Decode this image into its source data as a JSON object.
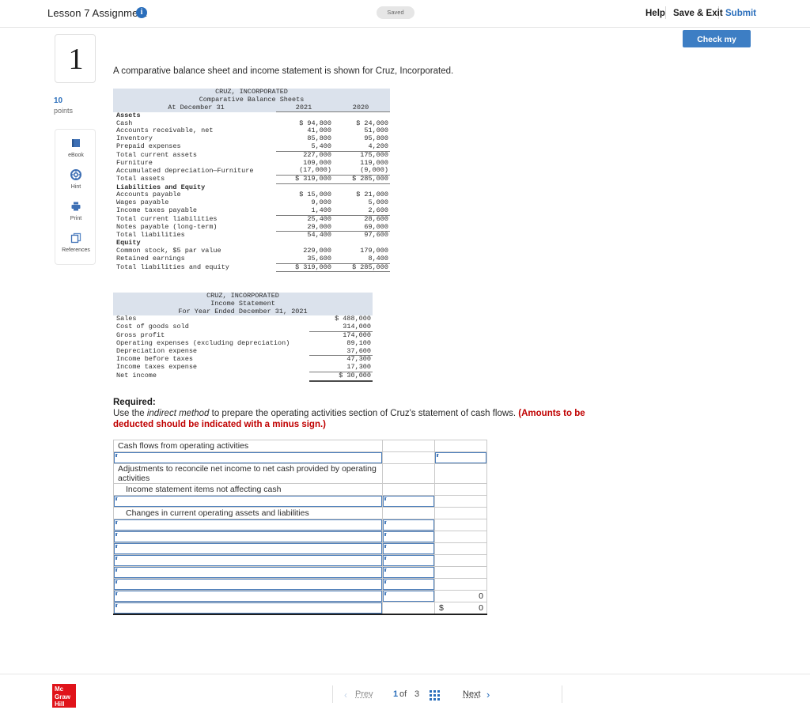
{
  "topbar": {
    "assignment_title": "Lesson 7 Assignment",
    "info_icon": "info-icon",
    "saved_label": "Saved",
    "help_label": "Help",
    "save_exit_label": "Save & Exit",
    "submit_label": "Submit",
    "check_my_work_label": "Check my work",
    "accent_blue": "#3d7ec4"
  },
  "left_rail": {
    "question_number": "1",
    "points_value": "10",
    "points_label": "points",
    "tools": [
      {
        "label": "eBook",
        "icon": "book-icon"
      },
      {
        "label": "Hint",
        "icon": "lifebuoy-icon"
      },
      {
        "label": "Print",
        "icon": "printer-icon"
      },
      {
        "label": "References",
        "icon": "copy-icon"
      }
    ]
  },
  "prompt": "A comparative balance sheet and income statement is shown for Cruz, Incorporated.",
  "balance_sheet": {
    "company": "CRUZ, INCORPORATED",
    "title": "Comparative Balance Sheets",
    "row_label_header": "At December 31",
    "col_2021": "2021",
    "col_2020": "2020",
    "rows": [
      {
        "label": "Assets",
        "bold": true,
        "v2021": "",
        "v2020": ""
      },
      {
        "label": "Cash",
        "v2021": "$ 94,800",
        "v2020": "$ 24,000"
      },
      {
        "label": "Accounts receivable, net",
        "v2021": "41,000",
        "v2020": "51,000"
      },
      {
        "label": "Inventory",
        "v2021": "85,800",
        "v2020": "95,800"
      },
      {
        "label": "Prepaid expenses",
        "v2021": "5,400",
        "v2020": "4,200",
        "rule": true
      },
      {
        "label": "Total current assets",
        "v2021": "227,000",
        "v2020": "175,000"
      },
      {
        "label": "Furniture",
        "v2021": "109,000",
        "v2020": "119,000"
      },
      {
        "label": "Accumulated depreciation—Furniture",
        "v2021": "(17,000)",
        "v2020": "(9,000)",
        "rule": true
      },
      {
        "label": "Total assets",
        "v2021": "$ 319,000",
        "v2020": "$ 285,000",
        "rule_after": true
      },
      {
        "label": "Liabilities and Equity",
        "bold": true,
        "v2021": "",
        "v2020": ""
      },
      {
        "label": "Accounts payable",
        "v2021": "$ 15,000",
        "v2020": "$ 21,000"
      },
      {
        "label": "Wages payable",
        "v2021": "9,000",
        "v2020": "5,000"
      },
      {
        "label": "Income taxes payable",
        "v2021": "1,400",
        "v2020": "2,600",
        "rule": true
      },
      {
        "label": "Total current liabilities",
        "v2021": "25,400",
        "v2020": "28,600"
      },
      {
        "label": "Notes payable (long-term)",
        "v2021": "29,000",
        "v2020": "69,000",
        "rule": true
      },
      {
        "label": "Total liabilities",
        "v2021": "54,400",
        "v2020": "97,600"
      },
      {
        "label": "Equity",
        "bold": true,
        "v2021": "",
        "v2020": ""
      },
      {
        "label": "Common stock, $5 par value",
        "v2021": "229,000",
        "v2020": "179,000"
      },
      {
        "label": "Retained earnings",
        "v2021": "35,600",
        "v2020": "8,400",
        "rule": true
      },
      {
        "label": "Total liabilities and equity",
        "v2021": "$ 319,000",
        "v2020": "$ 285,000",
        "rule_after": true
      }
    ]
  },
  "income_statement": {
    "company": "CRUZ, INCORPORATED",
    "title": "Income Statement",
    "period": "For Year Ended December 31, 2021",
    "rows": [
      {
        "label": "Sales",
        "value": "$ 488,000"
      },
      {
        "label": "Cost of goods sold",
        "value": "314,000",
        "rule": true
      },
      {
        "label": "Gross profit",
        "value": "174,000"
      },
      {
        "label": "Operating expenses (excluding depreciation)",
        "value": "89,100"
      },
      {
        "label": "Depreciation expense",
        "value": "37,600",
        "rule": true
      },
      {
        "label": "Income before taxes",
        "value": "47,300"
      },
      {
        "label": "Income taxes expense",
        "value": "17,300",
        "rule": true
      },
      {
        "label": "Net income",
        "value": "$ 30,000",
        "thick": true
      }
    ]
  },
  "required": {
    "heading": "Required:",
    "line_part1": "Use the ",
    "line_italic": "indirect method",
    "line_part2": " to prepare the operating activities section of Cruz's statement of cash flows. ",
    "line_red": "(Amounts to be deducted should be indicated with a minus sign.)"
  },
  "answer_grid": {
    "rows": [
      {
        "type": "static",
        "label": "Cash flows from operating activities",
        "indent": 0
      },
      {
        "type": "input",
        "label_value": "",
        "mid_value": null,
        "right_input": true,
        "right_value": ""
      },
      {
        "type": "static",
        "label": "Adjustments to reconcile net income to net cash provided by operating activities",
        "indent": 0
      },
      {
        "type": "static",
        "label": "Income statement items not affecting cash",
        "indent": 1
      },
      {
        "type": "input",
        "label_value": "",
        "mid_input": true,
        "mid_value": ""
      },
      {
        "type": "static",
        "label": "Changes in current operating assets and liabilities",
        "indent": 1
      },
      {
        "type": "input",
        "label_value": "",
        "mid_input": true,
        "mid_value": ""
      },
      {
        "type": "input",
        "label_value": "",
        "mid_input": true,
        "mid_value": ""
      },
      {
        "type": "input",
        "label_value": "",
        "mid_input": true,
        "mid_value": ""
      },
      {
        "type": "input",
        "label_value": "",
        "mid_input": true,
        "mid_value": ""
      },
      {
        "type": "input",
        "label_value": "",
        "mid_input": true,
        "mid_value": ""
      },
      {
        "type": "input",
        "label_value": "",
        "mid_input": true,
        "mid_value": ""
      },
      {
        "type": "input",
        "label_value": "",
        "mid_input": true,
        "mid_value": "",
        "right_text": "0"
      },
      {
        "type": "input",
        "label_value": "",
        "mid_value": null,
        "right_dollar": "$",
        "right_text": "0",
        "total": true
      }
    ]
  },
  "footer": {
    "logo_line1": "Mc",
    "logo_line2": "Graw",
    "logo_line3": "Hill",
    "prev_label": "Prev",
    "page_current": "1",
    "page_of": "of",
    "page_total": "3",
    "next_label": "Next",
    "grid_icon": "grid-icon"
  }
}
